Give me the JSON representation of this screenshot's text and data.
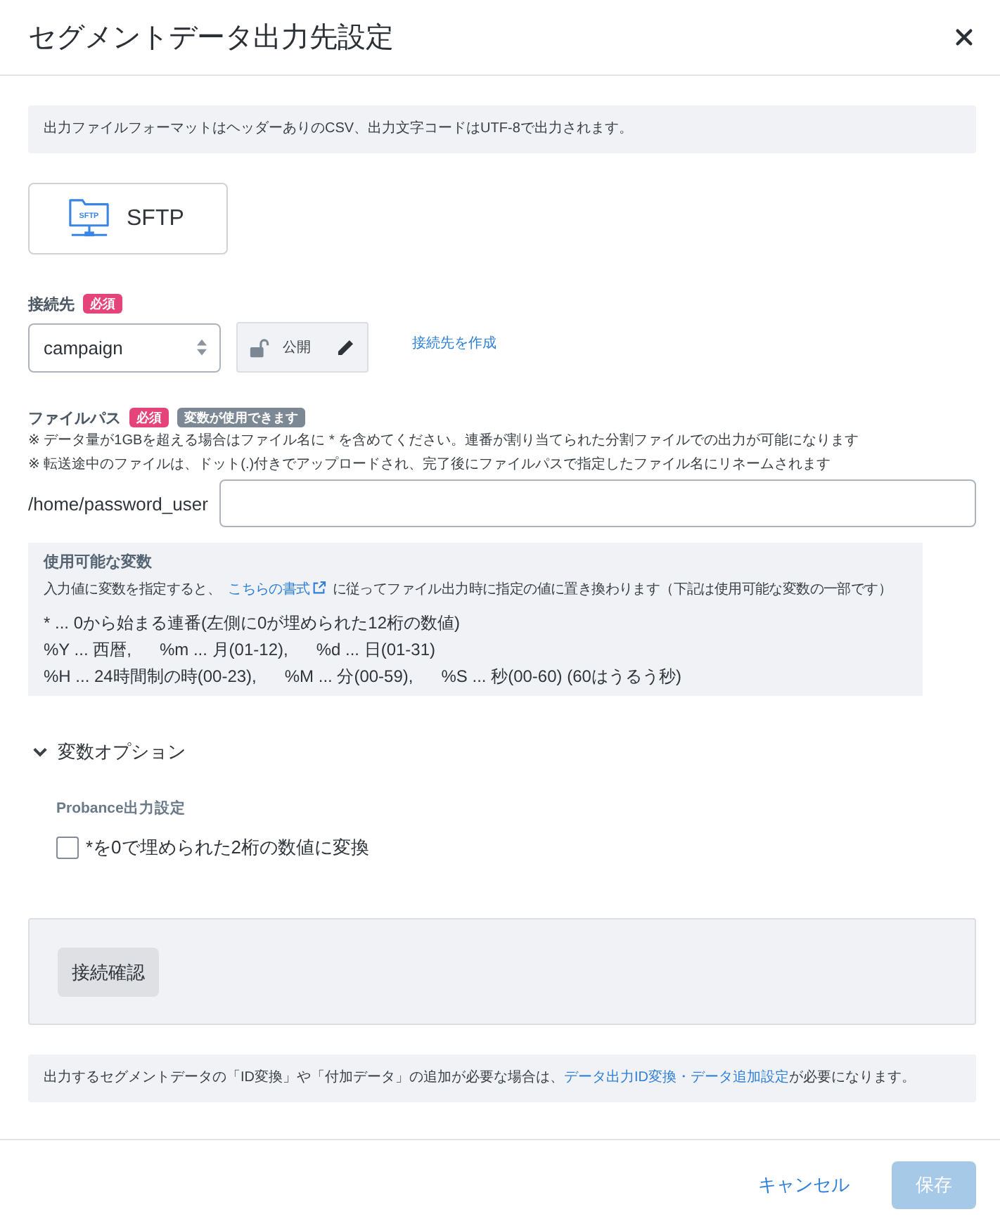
{
  "dialog": {
    "title": "セグメントデータ出力先設定"
  },
  "format_notice": "出力ファイルフォーマットはヘッダーありのCSV、出力文字コードはUTF-8で出力されます。",
  "destination_type": {
    "label": "SFTP",
    "icon_text": "SFTP"
  },
  "connection": {
    "label": "接続先",
    "badges": [
      {
        "text": "必須",
        "kind": "required"
      }
    ],
    "select_value": "campaign",
    "visibility_label": "公開",
    "create_link": "接続先を作成"
  },
  "file_path": {
    "label": "ファイルパス",
    "badges": [
      {
        "text": "必須",
        "kind": "required"
      },
      {
        "text": "変数が使用できます",
        "kind": "info"
      }
    ],
    "notes": [
      "※ データ量が1GBを超える場合はファイル名に * を含めてください。連番が割り当てられた分割ファイルでの出力が可能になります",
      "※ 転送途中のファイルは、ドット(.)付きでアップロードされ、完了後にファイルパスで指定したファイル名にリネームされます"
    ],
    "prefix": "/home/password_user"
  },
  "variables": {
    "title": "使用可能な変数",
    "description": [
      {
        "kind": "text",
        "text": "入力値に変数を指定すると、"
      },
      {
        "kind": "link",
        "text": "こちらの書式"
      },
      {
        "kind": "text",
        "text": "に従ってファイル出力時に指定の値に置き換わります（下記は使用可能な変数の一部です）"
      }
    ],
    "lines": [
      {
        "entries": [
          "* ... 0から始まる連番(左側に0が埋められた12桁の数値)"
        ]
      },
      {
        "entries": [
          "%Y ... 西暦,",
          "%m ... 月(01-12),",
          "%d ... 日(01-31)"
        ]
      },
      {
        "entries": [
          "%H ... 24時間制の時(00-23),",
          "%M ... 分(00-59),",
          "%S ... 秒(00-60) (60はうるう秒)"
        ]
      }
    ]
  },
  "variable_options": {
    "label": "変数オプション",
    "expanded": true,
    "section_title": "Probance出力設定",
    "options": [
      {
        "label": "*を0で埋められた2桁の数値に変換",
        "checked": false
      }
    ]
  },
  "connection_test": {
    "button": "接続確認"
  },
  "footer_notice": [
    {
      "kind": "text",
      "text": "出力するセグメントデータの「ID変換」や「付加データ」の追加が必要な場合は、"
    },
    {
      "kind": "link",
      "text": "データ出力ID変換・データ追加設定"
    },
    {
      "kind": "text",
      "text": "が必要になります。"
    }
  ],
  "footer": {
    "cancel": "キャンセル",
    "save": {
      "label": "保存",
      "disabled": true
    }
  }
}
